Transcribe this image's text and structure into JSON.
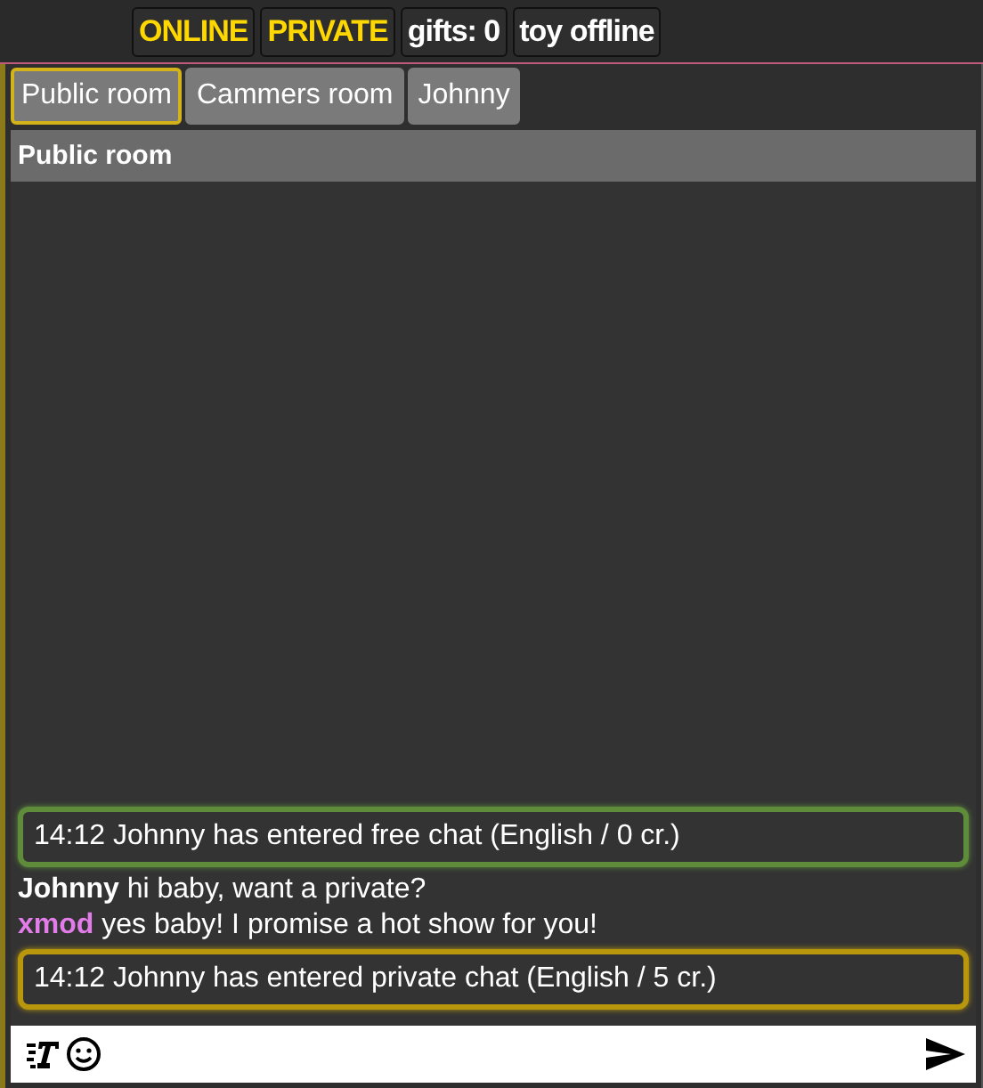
{
  "status_badges": [
    {
      "label": "ONLINE",
      "color": "#ffd700"
    },
    {
      "label": "PRIVATE",
      "color": "#ffd700"
    },
    {
      "label": "gifts: 0",
      "color": "#ffffff"
    },
    {
      "label": "toy offline",
      "color": "#ffffff"
    }
  ],
  "tabs": [
    {
      "label": "Public room",
      "selected": true
    },
    {
      "label": "Cammers room",
      "selected": false
    },
    {
      "label": "Johnny",
      "selected": false
    }
  ],
  "room_title": "Public room",
  "messages": [
    {
      "kind": "event",
      "text": "14:12 Johnny has entered free chat (English / 0 cr.)",
      "color": "#5e8c3a"
    },
    {
      "kind": "chat",
      "user": "Johnny",
      "text": "hi baby, want a private?",
      "color": "#ffffff"
    },
    {
      "kind": "chat",
      "user": "xmod",
      "text": "yes baby! I promise a hot show for you!",
      "color": "#e27ce8"
    },
    {
      "kind": "event",
      "text": "14:12 Johnny has entered private chat (English / 5 cr.)",
      "color": "#b8970c"
    }
  ]
}
